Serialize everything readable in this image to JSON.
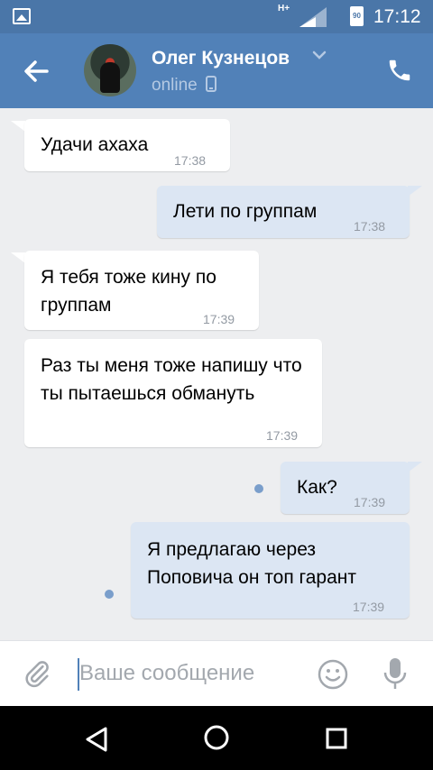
{
  "status_bar": {
    "network": "H+",
    "battery": "90",
    "time": "17:12"
  },
  "header": {
    "contact_name": "Олег Кузнецов",
    "status": "online",
    "icons": [
      "back-arrow-icon",
      "chevron-down-icon",
      "phone-icon",
      "mobile-icon"
    ]
  },
  "messages": [
    {
      "direction": "in",
      "text": "Удачи ахаха",
      "time": "17:38"
    },
    {
      "direction": "out",
      "text": "Лети по группам",
      "time": "17:38"
    },
    {
      "direction": "in",
      "text": "Я тебя тоже кину по группам",
      "time": "17:39"
    },
    {
      "direction": "in",
      "text": "Раз ты меня тоже напишу что ты пытаешься обмануть",
      "time": "17:39"
    },
    {
      "direction": "out",
      "text": "Как?",
      "time": "17:39",
      "unread": true
    },
    {
      "direction": "out",
      "text": "Я предлагаю через Поповича он топ гарант",
      "time": "17:39",
      "unread": true
    }
  ],
  "input": {
    "placeholder": "Ваше сообщение",
    "value": ""
  },
  "colors": {
    "header": "#5181b8",
    "status_bar": "#4a76a8",
    "chat_bg": "#edeef0",
    "outgoing_bubble": "#dce6f3",
    "incoming_bubble": "#ffffff"
  }
}
